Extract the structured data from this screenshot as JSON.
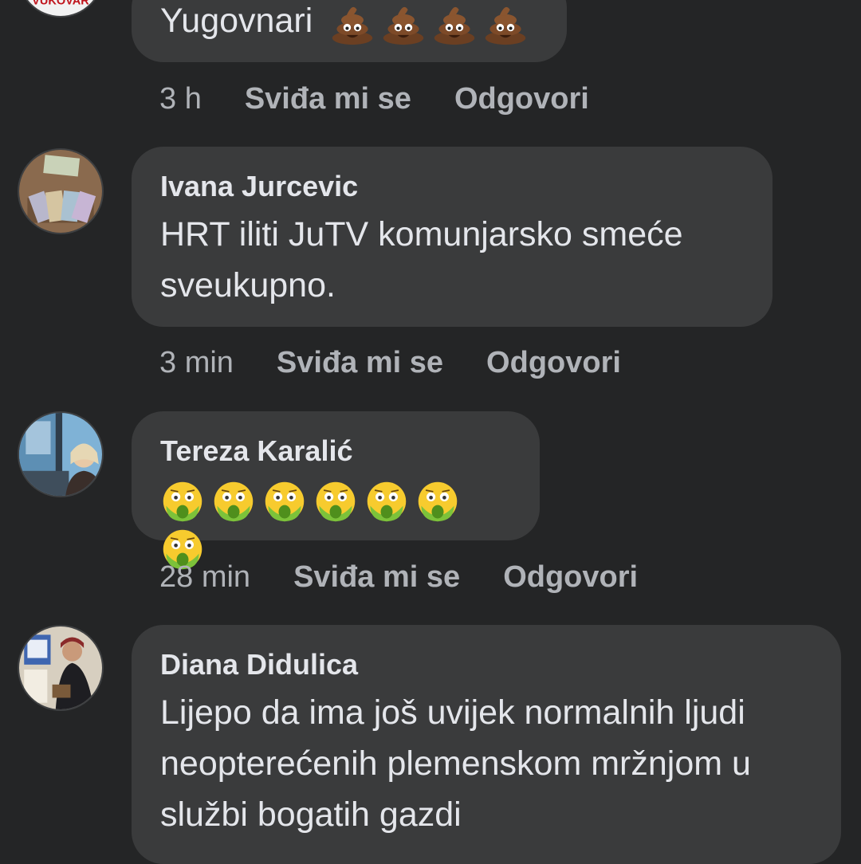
{
  "comments": [
    {
      "author": "",
      "avatar_text": "VUKOVAR",
      "text": "Yugovnari",
      "emoji_name": "pile-of-poo",
      "emoji_count": 4,
      "time": "3 h",
      "like_label": "Sviđa mi se",
      "reply_label": "Odgovori"
    },
    {
      "author": "Ivana Jurcevic",
      "text": "HRT iliti JuTV komunjarsko smeće sveukupno.",
      "time": "3 min",
      "like_label": "Sviđa mi se",
      "reply_label": "Odgovori"
    },
    {
      "author": "Tereza Karalić",
      "text": "",
      "emoji_name": "vomiting-face",
      "emoji_count": 7,
      "time": "28 min",
      "like_label": "Sviđa mi se",
      "reply_label": "Odgovori"
    },
    {
      "author": "Diana Didulica",
      "text": "Lijepo da ima još uvijek normalnih ljudi neopterećenih plemenskom mržnjom u službi bogatih gazdi",
      "time": "",
      "like_label": "",
      "reply_label": ""
    }
  ],
  "colors": {
    "background": "#242526",
    "bubble": "#3a3b3c",
    "text": "#e4e6eb",
    "secondary": "#b0b3b8"
  }
}
